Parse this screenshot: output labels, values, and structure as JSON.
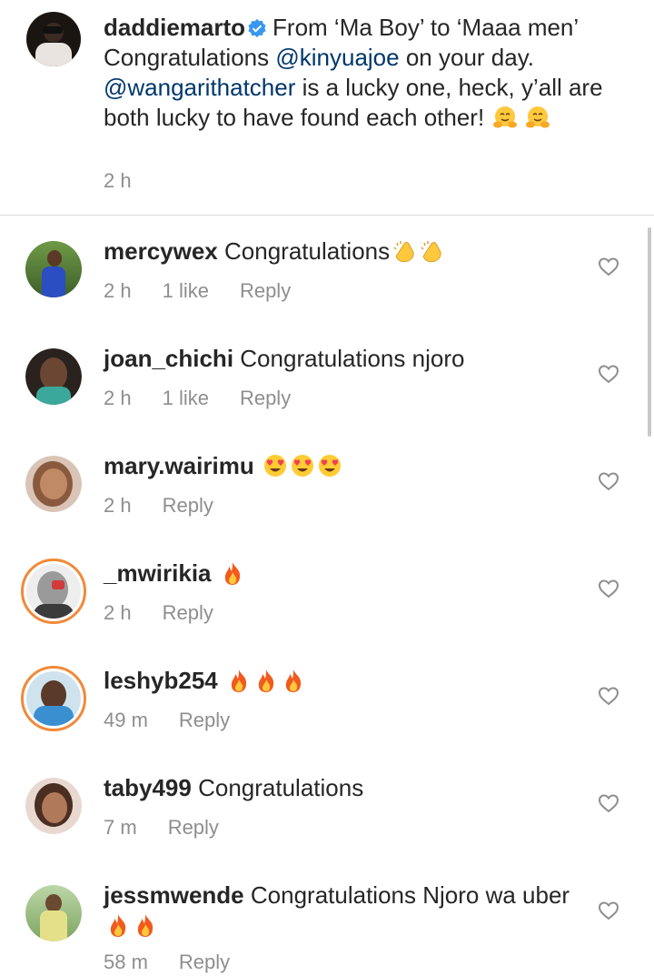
{
  "caption": {
    "username": "daddiemarto",
    "text_1": "From ‘Ma Boy’ to ‘Maaa men’ Congratulations",
    "mention_1": "@kinyuajoe",
    "text_2": "on your day.",
    "mention_2": "@wangarithatcher",
    "text_3": "is a lucky one, heck, y’all are both lucky to have found each other!",
    "time": "2 h"
  },
  "comments": [
    {
      "username": "mercywex",
      "text": "Congratulations",
      "time": "2 h",
      "likes": "1 like",
      "reply": "Reply"
    },
    {
      "username": "joan_chichi",
      "text": "Congratulations njoro",
      "time": "2 h",
      "likes": "1 like",
      "reply": "Reply"
    },
    {
      "username": "mary.wairimu",
      "text": "",
      "time": "2 h",
      "reply": "Reply"
    },
    {
      "username": "_mwirikia",
      "text": "",
      "time": "2 h",
      "reply": "Reply"
    },
    {
      "username": "leshyb254",
      "text": "",
      "time": "49 m",
      "reply": "Reply"
    },
    {
      "username": "taby499",
      "text": "Congratulations",
      "time": "7 m",
      "reply": "Reply"
    },
    {
      "username": "jessmwende",
      "text": "Congratulations Njoro wa uber",
      "time": "58 m",
      "reply": "Reply"
    }
  ],
  "colors": {
    "mention": "#00376b",
    "meta": "#8e8e8e",
    "story_ring": "#f08a3a",
    "verified": "#3897f0"
  },
  "icons": [
    "verified-badge-icon",
    "heart-outline-icon",
    "hugging-face-emoji",
    "clapping-hands-emoji",
    "heart-eyes-emoji",
    "fire-emoji"
  ]
}
